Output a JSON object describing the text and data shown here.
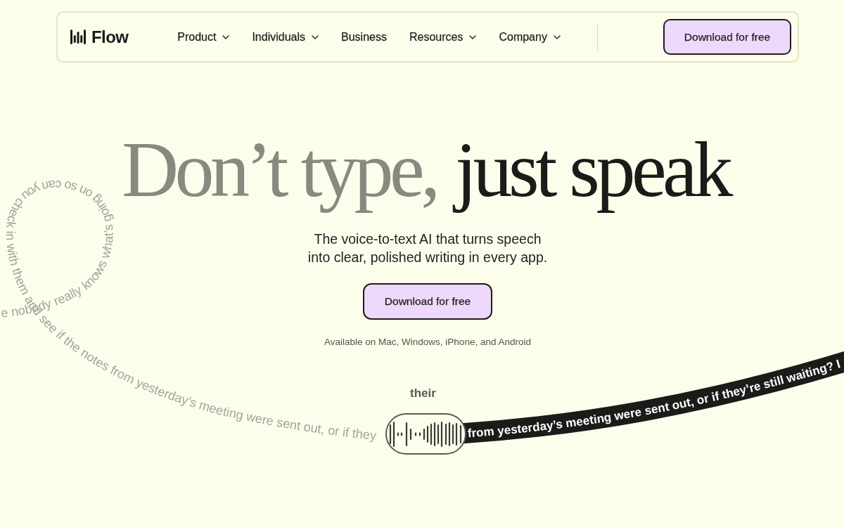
{
  "nav": {
    "brand": "Flow",
    "links": [
      {
        "label": "Product",
        "dropdown": true
      },
      {
        "label": "Individuals",
        "dropdown": true
      },
      {
        "label": "Business",
        "dropdown": false
      },
      {
        "label": "Resources",
        "dropdown": true
      },
      {
        "label": "Company",
        "dropdown": true
      }
    ],
    "cta": "Download for free"
  },
  "hero": {
    "headline": [
      {
        "text": "Don’t type,",
        "muted": true
      },
      {
        "text": "just speak",
        "muted": false
      }
    ],
    "subtitle": "The voice-to-text AI that turns speech into clear, polished writing in every app.",
    "cta": "Download for free",
    "availability": "Available on Mac, Windows, iPhone, and Android"
  },
  "transcript": {
    "trail_text": "e nobody really knows what’s going on so can you check in with them and see if the notes from yesterday’s meeting were sent out, or if they",
    "live_word": "their",
    "ribbon_text": "from yesterday’s meeting were sent out, or if they’re still waiting? I"
  }
}
